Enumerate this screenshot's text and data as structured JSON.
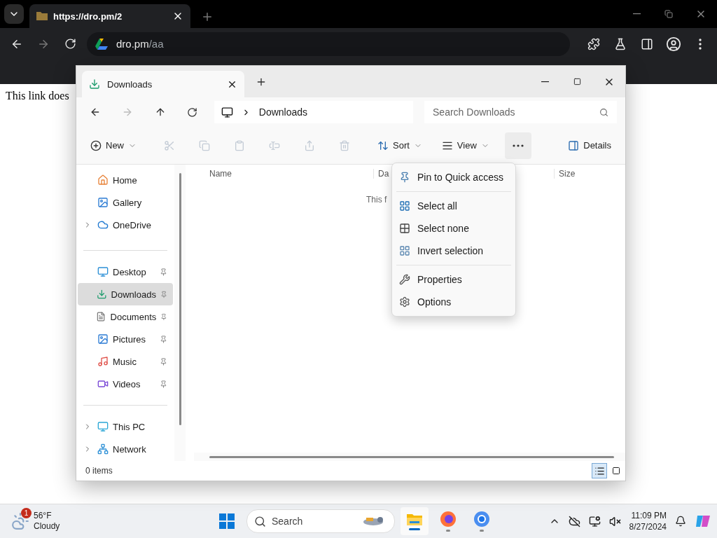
{
  "browser": {
    "tabs": [
      {
        "title": "https://dro.pm/2",
        "selected": true
      }
    ],
    "address": {
      "domain": "dro.pm",
      "path": "/aa"
    },
    "page_text": "This link does"
  },
  "explorer": {
    "tabs": [
      {
        "title": "Downloads",
        "selected": true
      }
    ],
    "breadcrumb": [
      "Downloads"
    ],
    "search": {
      "placeholder": "Search Downloads"
    },
    "commands": [
      {
        "kind": "new",
        "label": "New",
        "disabled": false,
        "selected": false
      },
      {
        "kind": "cut",
        "disabled": true,
        "selected": false
      },
      {
        "kind": "copy",
        "disabled": true,
        "selected": false
      },
      {
        "kind": "paste",
        "disabled": true,
        "selected": false
      },
      {
        "kind": "rename",
        "disabled": true,
        "selected": false
      },
      {
        "kind": "share",
        "disabled": true,
        "selected": false
      },
      {
        "kind": "delete",
        "disabled": true,
        "selected": false
      },
      {
        "kind": "sort",
        "label": "Sort",
        "disabled": false,
        "selected": false
      },
      {
        "kind": "view",
        "label": "View",
        "disabled": false,
        "selected": false
      },
      {
        "kind": "more",
        "disabled": false,
        "selected": true
      }
    ],
    "details_button": "Details",
    "nav_groups": [
      [
        {
          "label": "Home",
          "selected": false,
          "pinned": false,
          "expandable": false
        },
        {
          "label": "Gallery",
          "selected": false,
          "pinned": false,
          "expandable": false
        },
        {
          "label": "OneDrive",
          "selected": false,
          "pinned": false,
          "expandable": true
        }
      ],
      [
        {
          "label": "Desktop",
          "selected": false,
          "pinned": true,
          "expandable": false
        },
        {
          "label": "Downloads",
          "selected": true,
          "pinned": true,
          "expandable": false
        },
        {
          "label": "Documents",
          "selected": false,
          "pinned": true,
          "expandable": false
        },
        {
          "label": "Pictures",
          "selected": false,
          "pinned": true,
          "expandable": false
        },
        {
          "label": "Music",
          "selected": false,
          "pinned": true,
          "expandable": false
        },
        {
          "label": "Videos",
          "selected": false,
          "pinned": true,
          "expandable": false
        }
      ],
      [
        {
          "label": "This PC",
          "selected": false,
          "pinned": false,
          "expandable": true
        },
        {
          "label": "Network",
          "selected": false,
          "pinned": false,
          "expandable": true
        }
      ]
    ],
    "columns": [
      "Name",
      "Da",
      "Size"
    ],
    "empty_message": "This f",
    "status": "0 items",
    "view_modes": [
      {
        "kind": "details",
        "selected": true
      },
      {
        "kind": "tiles",
        "selected": false
      }
    ],
    "menu_groups": [
      [
        {
          "kind": "pin",
          "label": "Pin to Quick access"
        }
      ],
      [
        {
          "kind": "select-all",
          "label": "Select all"
        },
        {
          "kind": "select-none",
          "label": "Select none"
        },
        {
          "kind": "invert",
          "label": "Invert selection"
        }
      ],
      [
        {
          "kind": "properties",
          "label": "Properties"
        },
        {
          "kind": "options",
          "label": "Options"
        }
      ]
    ]
  },
  "taskbar": {
    "weather": {
      "badge": "1",
      "temperature": "56°F",
      "condition": "Cloudy"
    },
    "search": {
      "placeholder": "Search"
    },
    "apps": [
      {
        "kind": "files",
        "selected": true
      },
      {
        "kind": "firefox",
        "selected": false
      },
      {
        "kind": "chrome",
        "selected": false
      }
    ],
    "clock": {
      "time": "11:09 PM",
      "date": "8/27/2024"
    }
  }
}
